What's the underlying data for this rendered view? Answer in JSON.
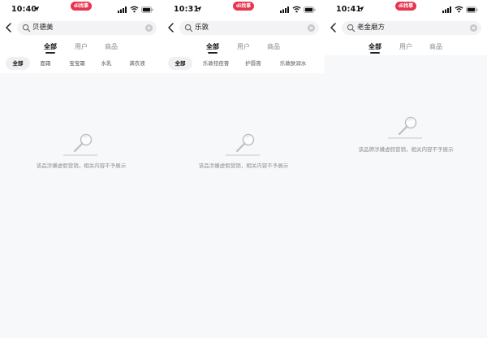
{
  "status_bar": {
    "badge": "di找事"
  },
  "screens": [
    {
      "time": "10:40",
      "search_value": "贝德美",
      "tabs": [
        "全部",
        "用户",
        "商品"
      ],
      "chips": [
        "全部",
        "面霜",
        "宝宝霜",
        "水乳",
        "满衣液"
      ],
      "empty_text": "该品涉嫌虚假营销，相关内容不予展示"
    },
    {
      "time": "10:31",
      "search_value": "乐敦",
      "tabs": [
        "全部",
        "用户",
        "商品"
      ],
      "chips": [
        "全部",
        "乐敦祛痘膏",
        "护唇膏",
        "乐敦肤润水"
      ],
      "empty_text": "该品涉嫌虚假营销，相关内容不予展示"
    },
    {
      "time": "10:41",
      "search_value": "老金磨方",
      "tabs": [
        "全部",
        "用户",
        "商品"
      ],
      "empty_text": "该品牌涉嫌虚假营销，相关内容不予展示"
    }
  ],
  "colors": {
    "badge": "#e8344c",
    "background": "#f7f8fa",
    "muted_text": "#8e8e93"
  },
  "icons": [
    "location-arrow-icon",
    "signal-icon",
    "wifi-icon",
    "battery-icon",
    "back-chevron-icon",
    "search-icon",
    "clear-icon",
    "magnifier-empty-icon"
  ]
}
